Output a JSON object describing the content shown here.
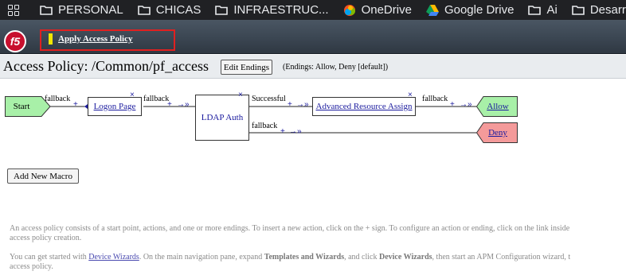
{
  "bookmarks": [
    {
      "label": "PERSONAL",
      "icon": "folder-icon"
    },
    {
      "label": "CHICAS",
      "icon": "folder-icon"
    },
    {
      "label": "INFRAESTRUC...",
      "icon": "folder-icon"
    },
    {
      "label": "OneDrive",
      "icon": "onedrive-icon"
    },
    {
      "label": "Google Drive",
      "icon": "google-drive-icon"
    },
    {
      "label": "Ai",
      "icon": "folder-icon"
    },
    {
      "label": "Desarrollo",
      "icon": "folder-icon"
    }
  ],
  "header": {
    "logo_text": "f5",
    "apply_label": "Apply Access Policy",
    "highlight_color": "#e02020"
  },
  "policy": {
    "title": "Access Policy: /Common/pf_access",
    "edit_endings_label": "Edit Endings",
    "endings_text": "(Endings: Allow, Deny [default])"
  },
  "flow": {
    "start": "Start",
    "logon": "Logon Page",
    "ldap": "LDAP Auth",
    "ara": "Advanced Resource Assign",
    "allow": "Allow",
    "deny": "Deny",
    "fallback": "fallback",
    "successful": "Successful",
    "plus": "+",
    "arrow": "→»",
    "x": "×",
    "colors": {
      "start": "#a8f0a8",
      "allow": "#a8f0a8",
      "deny": "#f49a9a",
      "link": "#1a1a9e"
    }
  },
  "add_macro_label": "Add New Macro",
  "help": {
    "p1_line1": "An access policy consists of a start point, actions, and one or more endings. To insert a new action, click on the + sign. To configure an action or ending, click on the link inside",
    "p1_line2": "access policy creation.",
    "p2_a": "You can get started with ",
    "p2_link": "Device Wizards",
    "p2_b": ". On the main navigation pane, expand ",
    "p2_bold1": "Templates and Wizards",
    "p2_c": ", and click ",
    "p2_bold2": "Device Wizards",
    "p2_d": ", then start an APM Configuration wizard, t",
    "p2_line2": "access policy."
  }
}
